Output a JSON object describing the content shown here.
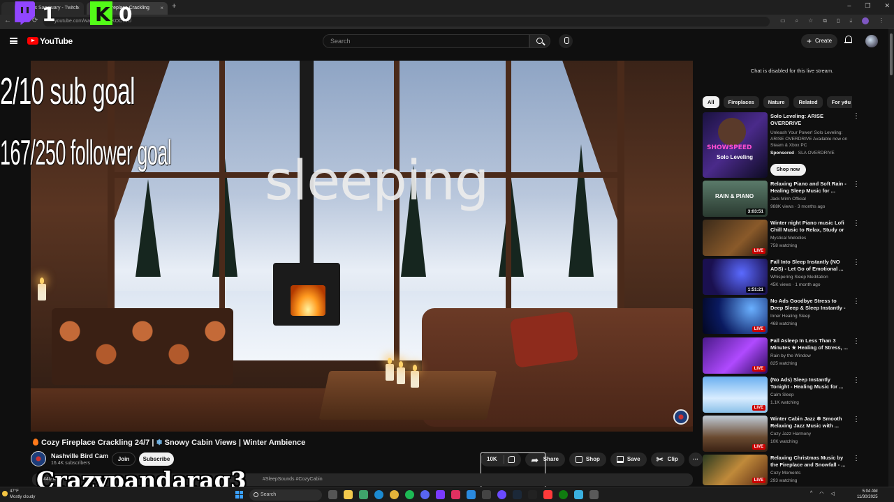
{
  "browser": {
    "tabs": [
      {
        "label": "Alveus Sanctuary - Twitch",
        "close": "×"
      },
      {
        "label": "Fireplace Crackling",
        "close": "×"
      }
    ],
    "new_tab": "+",
    "window_controls": [
      "–",
      "❐",
      "✕"
    ],
    "nav": [
      "←",
      "→",
      "⟳"
    ],
    "url": "youtube.com/watch?v=...FKOC7TU"
  },
  "overlays": {
    "twitch_count": "1",
    "kick_letter": "K",
    "kick_count": "0",
    "sub_goal": "2/10 sub goal",
    "follower_goal": "167/250 follower goal",
    "status_text": "sleeping",
    "streamer_name": "Crazypandarag3"
  },
  "header": {
    "logo": "YouTube",
    "search_placeholder": "Search",
    "create_label": "Create"
  },
  "video": {
    "title_part1": "Cozy Fireplace Crackling 24/7 |",
    "title_snow": "❄",
    "title_part2": "Snowy Cabin Views | Winter Ambience",
    "channel_name": "Nashville Bird Cam",
    "subscribers": "16.4K subscribers",
    "join_label": "Join",
    "subscribe_label": "Subscribe",
    "likes": "10K",
    "share_label": "Share",
    "shop_label": "Shop",
    "save_label": "Save",
    "clip_label": "Clip",
    "more_label": "⋯",
    "description_start": "440 watching",
    "description_tags": "#SleepSounds #CozyCabin"
  },
  "sidebar": {
    "chat_disabled": "Chat is disabled for this live stream.",
    "chips": [
      "All",
      "Fireplaces",
      "Nature",
      "Related",
      "For you"
    ],
    "chips_next": "›",
    "ad": {
      "title": "Solo Leveling: ARISE OVERDRIVE",
      "description": "Unleash Your Power! Solo Leveling: ARISE OVERDRIVE Available now on Steam & Xbox PC",
      "sponsored": "Sponsored",
      "advertiser": "· SLA OVERDRIVE",
      "cta": "Shop now",
      "thumb_brand": "SHOWSPEED",
      "thumb_brand2": "Solo Leveling"
    },
    "recommendations": [
      {
        "title": "Relaxing Piano and Soft Rain - Healing Sleep Music for ...",
        "channel": "Jack Minh Official",
        "meta": "988K views · 3 months ago",
        "badge": "3:03:51",
        "live": false
      },
      {
        "title": "Winter night Piano music Lofi Chill Music to Relax, Study or ...",
        "channel": "Mystical Melodies",
        "meta": "758 watching",
        "badge": "LIVE",
        "live": true
      },
      {
        "title": "Fall Into Sleep Instantly (NO ADS) - Let Go of Emotional ...",
        "channel": "Whispering Sleep Meditation",
        "meta": "45K views · 1 month ago",
        "badge": "1:51:21",
        "live": false
      },
      {
        "title": "No Ads Goodbye Stress to Deep Sleep & Sleep Instantly - ...",
        "channel": "Inner Healing Sleep",
        "meta": "468 watching",
        "badge": "LIVE",
        "live": true
      },
      {
        "title": "Fall Asleep In Less Than 3 Minutes ★ Healing of Stress, ...",
        "channel": "Rain by the Window",
        "meta": "825 watching",
        "badge": "LIVE",
        "live": true
      },
      {
        "title": "(No Ads) Sleep Instantly Tonight - Healing Music for ...",
        "channel": "Calm Sleep",
        "meta": "1.1K watching",
        "badge": "LIVE",
        "live": true
      },
      {
        "title": "Winter Cabin Jazz ❄ Smooth Relaxing Jazz Music with ...",
        "channel": "Cozy Jazz Harmony",
        "meta": "10K watching",
        "badge": "LIVE",
        "live": true
      },
      {
        "title": "Relaxing Christmas Music by the Fireplace and Snowfall - ...",
        "channel": "Cozy Moments",
        "meta": "293 watching",
        "badge": "LIVE",
        "live": true
      }
    ],
    "rain_piano_label": "RAIN & PIANO"
  },
  "taskbar": {
    "temperature": "47°F",
    "weather": "Mostly cloudy",
    "search": "Search",
    "time": "5:04 AM",
    "date": "11/30/2025"
  },
  "colors": {
    "youtube_red": "#ff0000",
    "twitch_purple": "#9146ff",
    "kick_green": "#53fc18",
    "live_red": "#cc0000"
  }
}
